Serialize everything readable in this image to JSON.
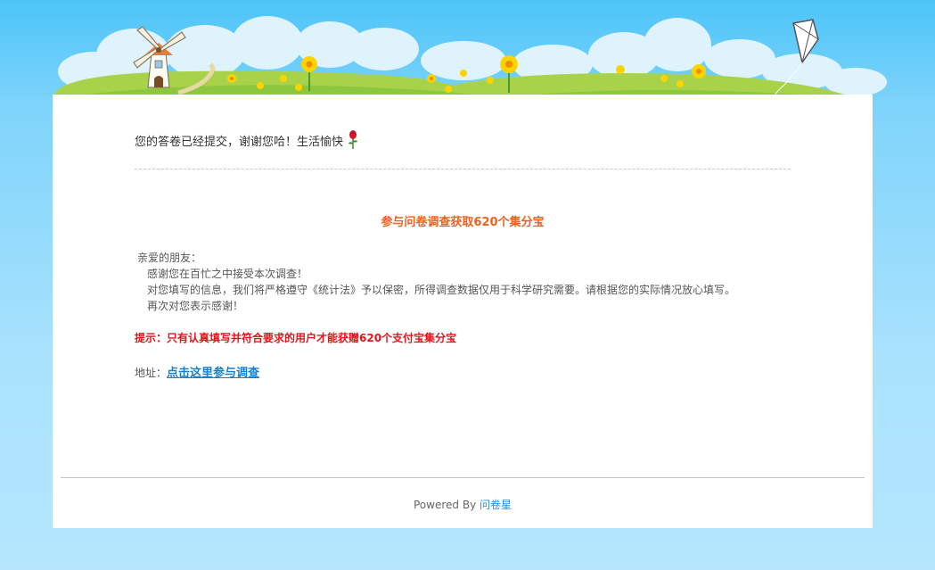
{
  "message": {
    "thanks": "您的答卷已经提交，谢谢您哈！生活愉快"
  },
  "promo": {
    "title": "参与问卷调查获取620个集分宝",
    "greeting": "亲爱的朋友：",
    "lines": [
      "感谢您在百忙之中接受本次调查！",
      "对您填写的信息，我们将严格遵守《统计法》予以保密，所得调查数据仅用于科学研究需要。请根据您的实际情况放心填写。",
      "再次对您表示感谢！"
    ],
    "tip": "提示：只有认真填写并符合要求的用户才能获赠620个支付宝集分宝",
    "address_label": "地址：",
    "address_link": "点击这里参与调查"
  },
  "footer": {
    "powered_by": "Powered By ",
    "brand": "问卷星"
  },
  "colors": {
    "headline": "#f0601e",
    "tip": "#e3141a",
    "link": "#1a7fc8",
    "sky": "#4cc4f8",
    "grass": "#8dc63f"
  },
  "icons": [
    "windmill-icon",
    "kite-icon",
    "flower-icon",
    "rose-icon"
  ]
}
